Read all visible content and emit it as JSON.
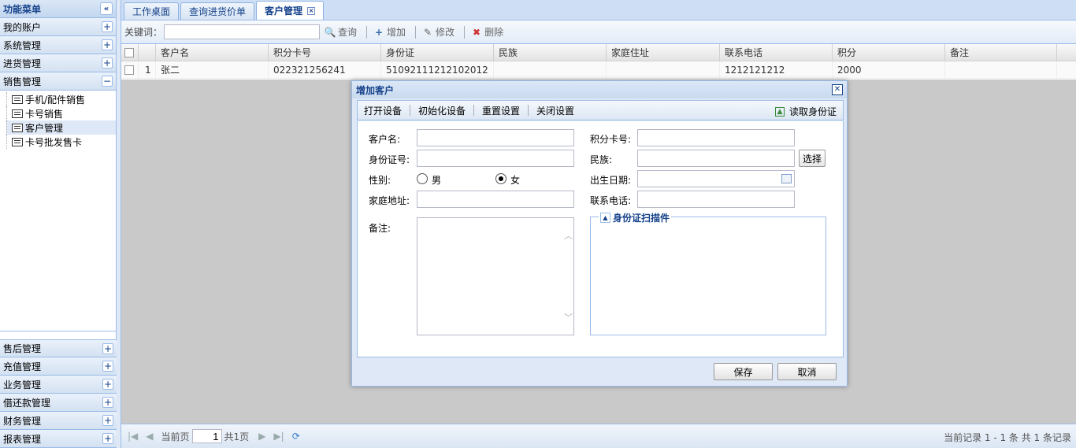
{
  "sidebar": {
    "title": "功能菜单",
    "groups_top": [
      "我的账户",
      "系统管理",
      "进货管理"
    ],
    "active_group": "销售管理",
    "tree_items": [
      "手机/配件销售",
      "卡号销售",
      "客户管理",
      "卡号批发售卡"
    ],
    "groups_bottom": [
      "售后管理",
      "充值管理",
      "业务管理",
      "借还款管理",
      "财务管理",
      "报表管理"
    ]
  },
  "tabs": [
    "工作桌面",
    "查询进货价单",
    "客户管理"
  ],
  "toolbar": {
    "keyword_label": "关键词：",
    "search": "查询",
    "add": "增加",
    "edit": "修改",
    "delete": "删除"
  },
  "grid": {
    "columns": [
      "客户名",
      "积分卡号",
      "身份证",
      "民族",
      "家庭住址",
      "联系电话",
      "积分",
      "备注"
    ],
    "rows": [
      {
        "index": "1",
        "name": "张二",
        "card": "022321256241",
        "id": "51092111212102012",
        "nation": "",
        "address": "",
        "phone": "1212121212",
        "points": "2000",
        "remark": ""
      }
    ]
  },
  "pager": {
    "current_label": "当前页",
    "page": "1",
    "total": "共1页",
    "info": "当前记录 1 - 1 条 共 1 条记录"
  },
  "dialog": {
    "title": "增加客户",
    "toolbar": [
      "打开设备",
      "初始化设备",
      "重置设置",
      "关闭设置"
    ],
    "read_id": "读取身份证",
    "fields": {
      "name": "客户名:",
      "card": "积分卡号:",
      "id_no": "身份证号:",
      "nation": "民族:",
      "gender": "性别:",
      "male": "男",
      "female": "女",
      "birth": "出生日期:",
      "address": "家庭地址:",
      "phone": "联系电话:",
      "remark": "备注:"
    },
    "select": "选择",
    "scan_legend": "身份证扫描件",
    "save": "保存",
    "cancel": "取消"
  }
}
